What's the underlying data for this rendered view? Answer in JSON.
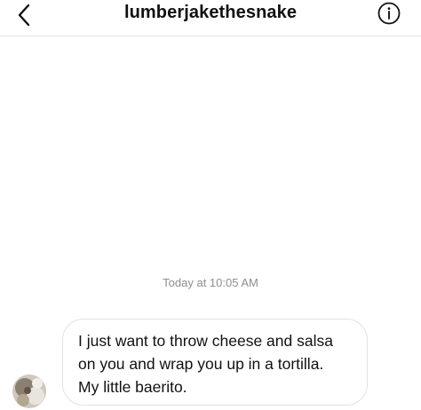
{
  "header": {
    "title": "lumberjakethesnake",
    "back_icon": "chevron-left-icon",
    "info_icon": "info-icon"
  },
  "conversation": {
    "timestamp": "Today at 10:05 AM",
    "messages": [
      {
        "sender": "other",
        "text": "I just want to throw cheese and salsa\non you and wrap you up in a tortilla.\nMy little baerito."
      }
    ]
  },
  "colors": {
    "text": "#111111",
    "timestamp": "#8e8e8e",
    "bubble_border": "#e2e2e2",
    "divider": "#e4e4e4"
  }
}
